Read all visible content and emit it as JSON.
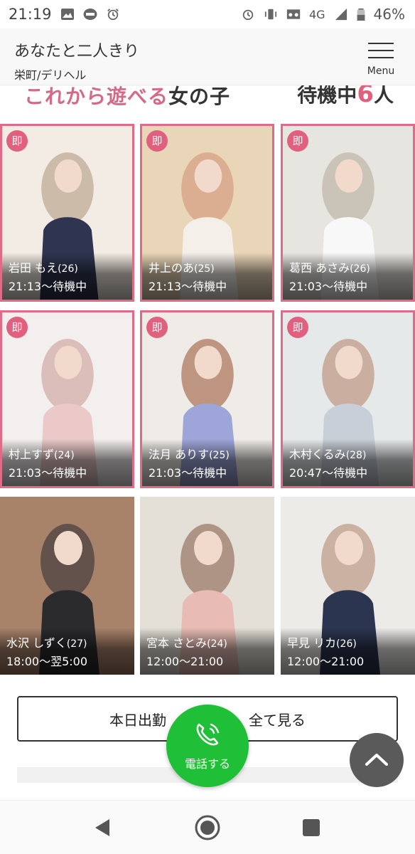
{
  "status_bar": {
    "time": "21:19",
    "network": "4G",
    "battery": "46%",
    "icons_left": [
      "image-icon",
      "line-app-icon",
      "alarm-icon"
    ],
    "icons_right": [
      "alarm-icon",
      "vibrate-icon",
      "voicemail-icon",
      "signal-icon",
      "battery-icon"
    ]
  },
  "header": {
    "title": "あなたと二人きり",
    "subtitle": "栄町/デリヘル",
    "menu_label": "Menu"
  },
  "section": {
    "title_pink": "これから遊べる",
    "title_dark": "女の子",
    "count_prefix": "待機中",
    "count": "6",
    "count_suffix": "人"
  },
  "badge_label": "即",
  "cards": [
    {
      "name": "岩田 もえ",
      "age": "(26)",
      "time": "21:13〜待機中",
      "badge": true,
      "tones": [
        "#f3ece4",
        "#c8b6a2",
        "#2f3550"
      ]
    },
    {
      "name": "井上のあ",
      "age": "(25)",
      "time": "21:13〜待機中",
      "badge": true,
      "tones": [
        "#e9d5b7",
        "#d9a98d",
        "#f4efe9"
      ]
    },
    {
      "name": "葛西 あさみ",
      "age": "(26)",
      "time": "21:03〜待機中",
      "badge": true,
      "tones": [
        "#e7e5e0",
        "#c6bfb2",
        "#f8f8f8"
      ]
    },
    {
      "name": "村上すず",
      "age": "(24)",
      "time": "21:03〜待機中",
      "badge": true,
      "tones": [
        "#f4efef",
        "#d8b8b4",
        "#eac9c8"
      ]
    },
    {
      "name": "法月 ありす",
      "age": "(25)",
      "time": "21:03〜待機中",
      "badge": true,
      "tones": [
        "#efece7",
        "#b88c74",
        "#9ea6d9"
      ]
    },
    {
      "name": "木村くるみ",
      "age": "(28)",
      "time": "20:47〜待機中",
      "badge": true,
      "tones": [
        "#e6e9ea",
        "#c7a898",
        "#c9cfd8"
      ]
    },
    {
      "name": "水沢 しずく",
      "age": "(27)",
      "time": "18:00〜翌5:00",
      "badge": false,
      "tones": [
        "#a9826a",
        "#5a4c48",
        "#2b2b2e"
      ]
    },
    {
      "name": "宮本 さとみ",
      "age": "(24)",
      "time": "12:00〜21:00",
      "badge": false,
      "tones": [
        "#e4e0d8",
        "#a78c7c",
        "#e8bcb4"
      ]
    },
    {
      "name": "早見 リカ",
      "age": "(26)",
      "time": "12:00〜21:00",
      "badge": false,
      "tones": [
        "#ecebe8",
        "#c7ab9a",
        "#2c3550"
      ]
    }
  ],
  "view_all": {
    "part1": "本日出勤",
    "part2": "全て見る"
  },
  "call": {
    "label": "電話する"
  },
  "colors": {
    "accent_pink": "#e0607e",
    "call_green": "#1fbf38"
  }
}
